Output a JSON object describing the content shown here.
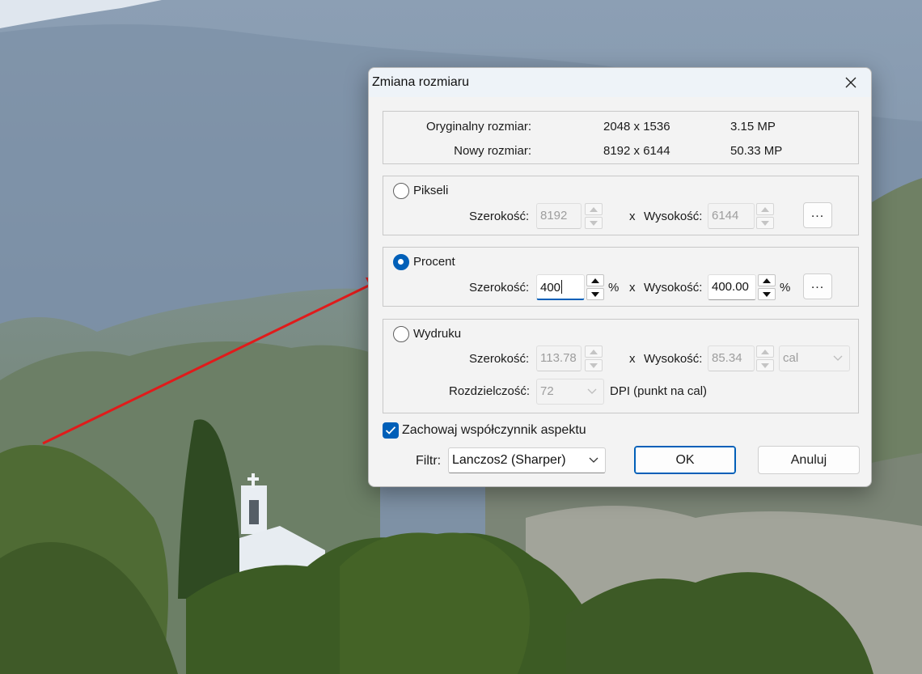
{
  "dialog": {
    "title": "Zmiana rozmiaru",
    "info": {
      "original_label": "Oryginalny rozmiar:",
      "original_dims": "2048 x 1536",
      "original_mp": "3.15 MP",
      "new_label": "Nowy rozmiar:",
      "new_dims": "8192 x 6144",
      "new_mp": "50.33 MP"
    },
    "pixels": {
      "label": "Pikseli",
      "selected": false,
      "width_label": "Szerokość:",
      "width_value": "8192",
      "x_label": "x",
      "height_label": "Wysokość:",
      "height_value": "6144",
      "more_label": "..."
    },
    "percent": {
      "label": "Procent",
      "selected": true,
      "width_label": "Szerokość:",
      "width_value": "400",
      "width_unit": "%",
      "x_label": "x",
      "height_label": "Wysokość:",
      "height_value": "400.00",
      "height_unit": "%",
      "more_label": "..."
    },
    "print": {
      "label": "Wydruku",
      "selected": false,
      "width_label": "Szerokość:",
      "width_value": "113.78",
      "x_label": "x",
      "height_label": "Wysokość:",
      "height_value": "85.34",
      "unit_value": "cal",
      "resolution_label": "Rozdzielczość:",
      "resolution_value": "72",
      "resolution_unit": "DPI (punkt na cal)"
    },
    "keep_aspect": {
      "label": "Zachowaj współczynnik aspektu",
      "checked": true
    },
    "filter": {
      "label": "Filtr:",
      "value": "Lanczos2 (Sharper)"
    },
    "ok_label": "OK",
    "cancel_label": "Anuluj"
  },
  "colors": {
    "accent": "#005fb8",
    "annotation_arrow": "#e01b1b"
  }
}
